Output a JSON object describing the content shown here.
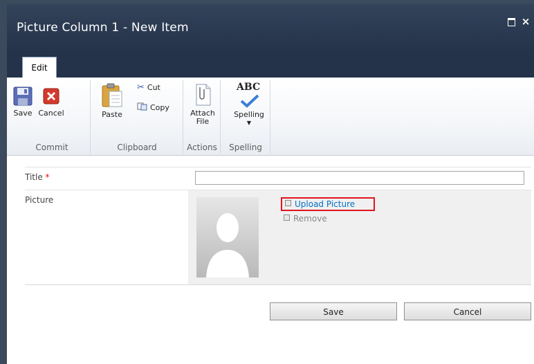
{
  "window": {
    "title": "Picture Column 1 - New Item",
    "maximize_glyph": "",
    "close_glyph": "×"
  },
  "ribbon": {
    "tab_label": "Edit",
    "buttons": {
      "save": "Save",
      "cancel": "Cancel",
      "paste": "Paste",
      "cut": "Cut",
      "copy": "Copy",
      "attach_line1": "Attach",
      "attach_line2": "File",
      "spelling": "Spelling",
      "spelling_icon_text": "ABC"
    },
    "groups": {
      "commit": "Commit",
      "clipboard": "Clipboard",
      "actions": "Actions",
      "spelling": "Spelling"
    }
  },
  "form": {
    "title_label": "Title",
    "required_mark": "*",
    "title_value": "",
    "picture_label": "Picture",
    "upload_link": "Upload Picture",
    "remove_link": "Remove"
  },
  "actions": {
    "save": "Save",
    "cancel": "Cancel"
  },
  "colors": {
    "titlebar": "#33435a",
    "link": "#0072c6",
    "highlight_border": "#e0141e",
    "required": "#e00000"
  }
}
